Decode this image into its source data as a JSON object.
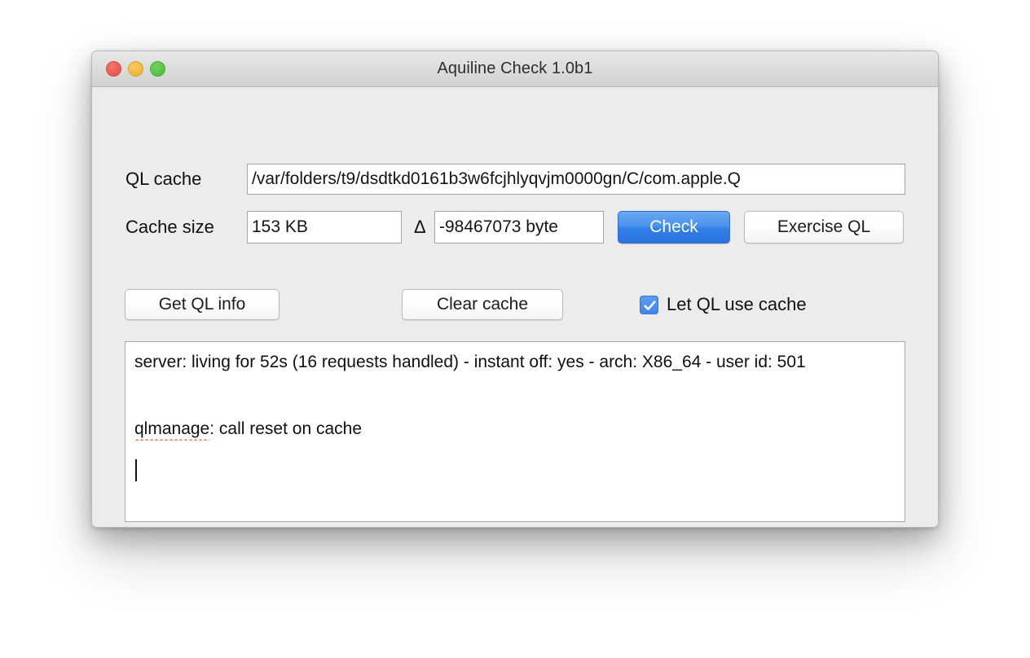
{
  "window": {
    "title": "Aquiline Check 1.0b1",
    "traffic_lights": {
      "close": "close-button",
      "minimize": "minimize-button",
      "maximize": "maximize-button"
    },
    "colors": {
      "window_background": "#ececec",
      "titlebar_top": "#e9e9e9",
      "titlebar_bottom": "#d2d2d2",
      "close": "#ea5f57",
      "minimize": "#f2bb41",
      "maximize": "#5dc64a",
      "accent_blue": "#3180e6",
      "checkbox_blue": "#3f86ef",
      "field_border": "#a4a4a4",
      "misspelled_underline": "#f26b5e"
    }
  },
  "form": {
    "ql_cache_label": "QL cache",
    "ql_cache_value": "/var/folders/t9/dsdtkd0161b3w6fcjhlyqvjm0000gn/C/com.apple.Q",
    "cache_size_label": "Cache size",
    "cache_size_value": "153 KB",
    "delta_symbol": "Δ",
    "delta_value": "-98467073 byte",
    "check_button": "Check",
    "exercise_ql_button": "Exercise QL",
    "get_ql_info_button": "Get QL info",
    "clear_cache_button": "Clear cache",
    "let_ql_use_cache_label": "Let QL use cache",
    "let_ql_use_cache_checked": true
  },
  "log": {
    "line1": "server: living for 52s (16 requests handled) - instant off: yes - arch: X86_64 - user id: 501",
    "line2_misspelled": "qlmanage",
    "line2_rest": ": call reset on cache"
  }
}
